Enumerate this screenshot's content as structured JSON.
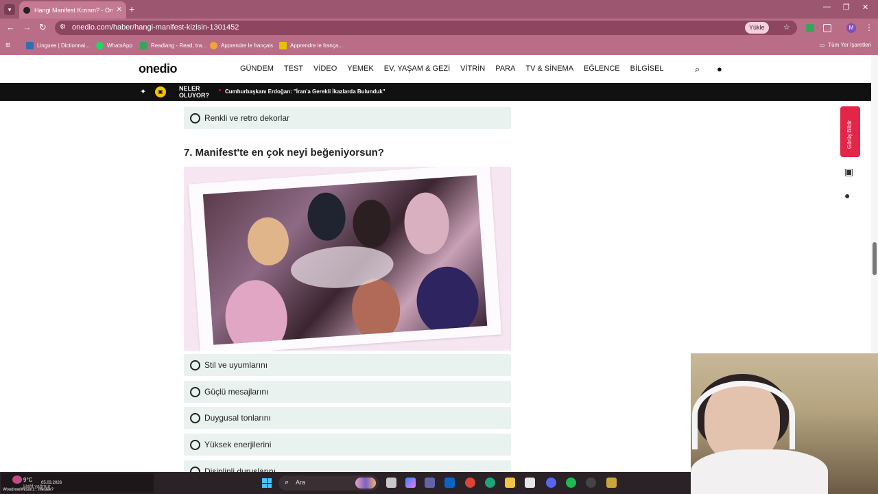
{
  "browser": {
    "tab_title": "Hangi Manifest Kızısın? - Onedio",
    "url": "onedio.com/haber/hangi-manifest-kizisin-1301452",
    "install_label": "Yükle",
    "profile_initial": "M",
    "bookmarks": [
      {
        "label": "Linguee | Dictionnai...",
        "color": "#2f6fb3"
      },
      {
        "label": "WhatsApp",
        "color": "#25d366"
      },
      {
        "label": "Readlang - Read, tra...",
        "color": "#3aa35b"
      },
      {
        "label": "Apprendre le français",
        "color": "#f2a33a"
      },
      {
        "label": "Apprendre le frança...",
        "color": "#e8c200"
      }
    ],
    "all_bookmarks_label": "Tüm Yer İşaretleri"
  },
  "site": {
    "logo": "onedio",
    "nav": [
      "GÜNDEM",
      "TEST",
      "VİDEO",
      "YEMEK",
      "EV, YAŞAM & GEZİ",
      "VİTRİN",
      "PARA",
      "TV & SİNEMA",
      "EĞLENCE",
      "BİLGİSEL"
    ],
    "newsbar_label_1": "NELER",
    "newsbar_label_2": "OLUYOR?",
    "newsbar_headline": "Cumhurbaşkanı Erdoğan: \"İran'a Gerekli İkazlarda Bulunduk\""
  },
  "quiz": {
    "prev_option": "Renkli ve retro dekorlar",
    "question": "7. Manifest'te en çok neyi beğeniyorsun?",
    "options": [
      "Stil ve uyumlarını",
      "Güçlü mesajlarını",
      "Duygusal tonlarını",
      "Yüksek enerjilerini",
      "Disiplinli duruşlarını"
    ]
  },
  "sidebar": {
    "feedback_label": "Görüş Bildir"
  },
  "taskbar": {
    "temp": "9°C",
    "condition": "Hafif yağmur",
    "date": "05.03.2026",
    "overlay_text": "WoodrowWilson1 : meslek?",
    "search_placeholder": "Ara"
  },
  "colors": {
    "chrome": "#b96d86",
    "option_bg": "#e9f2ee",
    "feedback": "#e4254a"
  }
}
